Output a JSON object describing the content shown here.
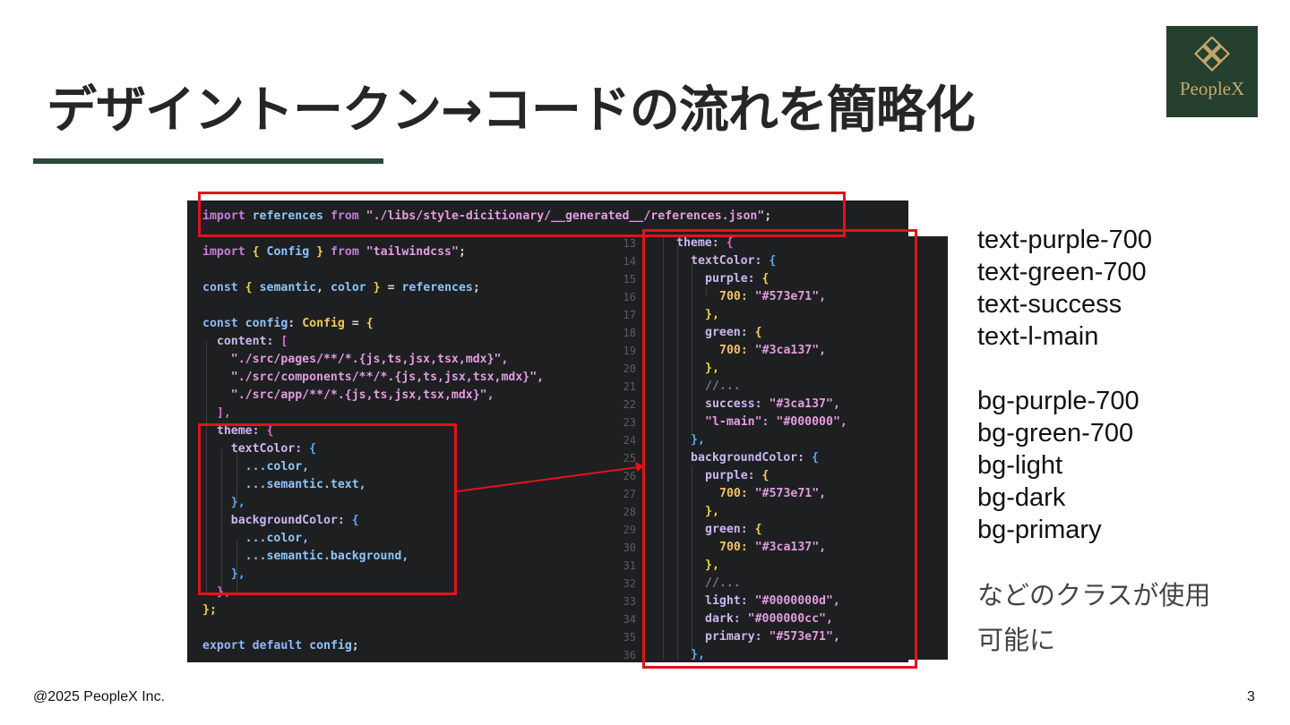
{
  "slide": {
    "title": "デザイントークン→コードの流れを簡略化",
    "logo_text": "PeopleX",
    "footer": "@2025 PeopleX Inc.",
    "page_number": "3"
  },
  "colors": {
    "accent": "#2c4a3a",
    "logo_bg": "#25402f",
    "logo_gold": "#c9a86a",
    "highlight": "#e0141a",
    "code_bg": "#1e1f21"
  },
  "code_left": {
    "import_references": {
      "kw": "import",
      "name": "references",
      "from": "from",
      "path": "\"./libs/style-dicitionary/__generated__/references.json\"",
      "end": ";"
    },
    "import_config": {
      "kw": "import",
      "open": "{",
      "name": "Config",
      "close": "}",
      "from": "from",
      "path": "\"tailwindcss\"",
      "end": ";"
    },
    "destructure": {
      "kw": "const",
      "open": "{",
      "a": "semantic",
      "comma": ",",
      "b": "color",
      "close": "}",
      "eq": "=",
      "src": "references",
      "end": ";"
    },
    "config_decl": {
      "kw": "const",
      "name": "config",
      "colon": ":",
      "type": "Config",
      "eq": "=",
      "open": "{"
    },
    "content_key": "content:",
    "content_open": "[",
    "paths": [
      "\"./src/pages/**/*.{js,ts,jsx,tsx,mdx}\",",
      "\"./src/components/**/*.{js,ts,jsx,tsx,mdx}\",",
      "\"./src/app/**/*.{js,ts,jsx,tsx,mdx}\","
    ],
    "content_close": "],",
    "theme_key": "theme:",
    "theme_open": "{",
    "text_color_key": "textColor:",
    "text_color_open": "{",
    "spread_color": "...color,",
    "spread_semantic_text_a": "...semantic.",
    "spread_semantic_text_b": "text,",
    "close_brace_blue": "},",
    "background_color_key": "backgroundColor:",
    "spread_semantic_bg_a": "...semantic.",
    "spread_semantic_bg_b": "background,",
    "theme_close": "},",
    "config_close": "};",
    "export_line": {
      "kw1": "export",
      "kw2": "default",
      "name": "config",
      "end": ";"
    }
  },
  "code_right": {
    "line_numbers": [
      "13",
      "14",
      "15",
      "16",
      "17",
      "18",
      "19",
      "20",
      "21",
      "22",
      "23",
      "24",
      "25",
      "26",
      "27",
      "28",
      "29",
      "30",
      "31",
      "32",
      "33",
      "34",
      "35",
      "36"
    ],
    "theme_key": "theme:",
    "text_color_key": "textColor:",
    "background_color_key": "backgroundColor:",
    "purple_key": "purple:",
    "green_key": "green:",
    "open_brace": "{",
    "close_brace": "},",
    "key_700": "700:",
    "value_purple": "\"#573e71\",",
    "value_green": "\"#3ca137\",",
    "comment": "//...",
    "success_key": "success:",
    "success_value": "\"#3ca137\",",
    "lmain_key": "\"l-main\":",
    "lmain_value": "\"#000000\",",
    "light_key": "light:",
    "light_value": "\"#0000000d\",",
    "dark_key": "dark:",
    "dark_value": "\"#000000cc\",",
    "primary_key": "primary:",
    "primary_value": "\"#573e71\","
  },
  "side_list": {
    "text_classes": [
      "text-purple-700",
      "text-green-700",
      "text-success",
      "text-l-main"
    ],
    "bg_classes": [
      "bg-purple-700",
      "bg-green-700",
      "bg-light",
      "bg-dark",
      "bg-primary"
    ],
    "note": "などのクラスが使用可能に"
  }
}
